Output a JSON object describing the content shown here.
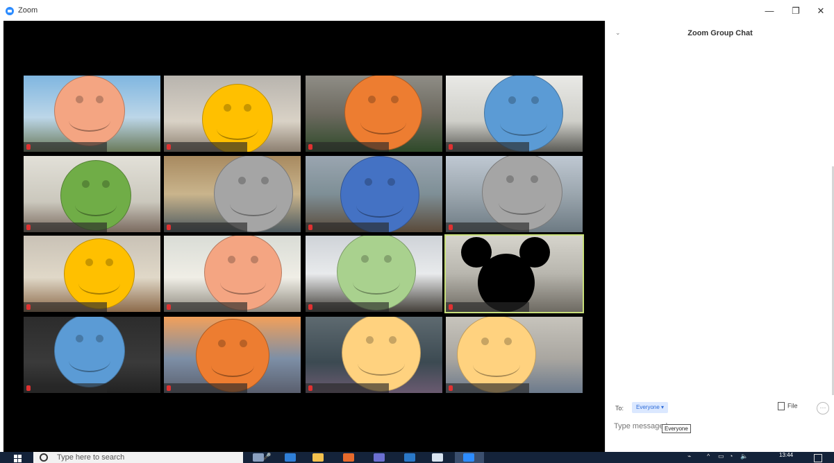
{
  "window": {
    "app_title": "Zoom",
    "minimize_glyph": "—",
    "restore_glyph": "❐",
    "close_glyph": "✕"
  },
  "gallery": {
    "tiles": [
      {
        "bg": "linear-gradient(180deg,#7fb6e0 0%,#bcd6e8 55%,#6a7a5a 100%)",
        "face_color": "#f4a582"
      },
      {
        "bg": "linear-gradient(180deg,#b8b4ae 0%,#d9d2c6 60%,#8c7f70 100%)",
        "face_color": "#ffc000"
      },
      {
        "bg": "linear-gradient(180deg,#8f8d86 0%,#6d6a60 50%,#2f4a2a 100%)",
        "face_color": "#ed7d31"
      },
      {
        "bg": "linear-gradient(180deg,#e9e9e6 0%,#cfcfc9 60%,#5a5a55 100%)",
        "face_color": "#5b9bd5"
      },
      {
        "bg": "linear-gradient(180deg,#e2e0d8 0%,#cbc8bd 60%,#7a6a5f 100%)",
        "face_color": "#70ad47"
      },
      {
        "bg": "linear-gradient(180deg,#a88a60 0%,#c9b48c 50%,#4d5a60 100%)",
        "face_color": "#a5a5a5"
      },
      {
        "bg": "linear-gradient(180deg,#9aa5b0 0%,#7e8f96 50%,#5a4a3a 100%)",
        "face_color": "#4472c4"
      },
      {
        "bg": "linear-gradient(180deg,#bfc8d2 0%,#9ba6ae 50%,#6d7a83 100%)",
        "face_color": "#a5a5a5"
      },
      {
        "bg": "linear-gradient(180deg,#c9c2b6 0%,#e0d8c8 55%,#8c6a4a 100%)",
        "face_color": "#ffc000"
      },
      {
        "bg": "linear-gradient(180deg,#d9dcd6 0%,#f0eee6 55%,#8f8a80 100%)",
        "face_color": "#f4a582"
      },
      {
        "bg": "linear-gradient(180deg,#cfd3d8 0%,#e8eaec 50%,#44403a 100%)",
        "face_color": "#a9d18e"
      },
      {
        "bg": "linear-gradient(180deg,#d6d4cc 0%,#b8b6ae 50%,#6e6a62 100%)",
        "face_color": "mickey"
      },
      {
        "bg": "linear-gradient(180deg,#2c2c2c 0%,#3a3a3a 60%,#222 100%)",
        "face_color": "#5b9bd5"
      },
      {
        "bg": "linear-gradient(180deg,#f2a05a 0%,#7d8fa6 55%,#5a5f6e 100%)",
        "face_color": "#ed7d31"
      },
      {
        "bg": "linear-gradient(180deg,#5e6a70 0%,#3c4a52 60%,#6a5a70 100%)",
        "face_color": "#ffd27f"
      },
      {
        "bg": "linear-gradient(180deg,#c7c4bc 0%,#a9a6a0 55%,#6c7a8c 100%)",
        "face_color": "#ffd27f"
      }
    ]
  },
  "chat": {
    "title": "Zoom Group Chat",
    "collapse_glyph": "⌄",
    "to_label": "To:",
    "recipient": "Everyone",
    "recipient_caret": "▾",
    "file_label": "File",
    "more_glyph": "···",
    "message_placeholder": "Type message here...",
    "tooltip": "Everyone"
  },
  "taskbar": {
    "search_placeholder": "Type here to search",
    "time": "13:44",
    "apps": [
      {
        "icon": "task-view-icon",
        "color": "#8aa0c0"
      },
      {
        "icon": "edge-icon",
        "color": "#2f7fd8"
      },
      {
        "icon": "file-explorer-icon",
        "color": "#f2c14e"
      },
      {
        "icon": "firefox-icon",
        "color": "#e66a2c"
      },
      {
        "icon": "teams-icon",
        "color": "#6b6fd1"
      },
      {
        "icon": "outlook-icon",
        "color": "#2a78c8"
      },
      {
        "icon": "paint-icon",
        "color": "#d8e4f0"
      },
      {
        "icon": "zoom-icon",
        "color": "#2d8cff"
      }
    ]
  }
}
